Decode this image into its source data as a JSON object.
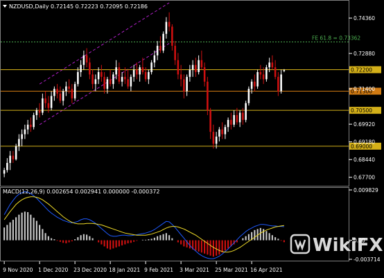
{
  "chart_data": [
    {
      "type": "candlestick",
      "title": "NZDUSD,Daily",
      "header_values": "0.72145 0.72223 0.72095 0.72186",
      "ylim": [
        0.674,
        0.75
      ],
      "y_ticks": [
        "0.74360",
        "0.72880",
        "0.71400",
        "0.69920",
        "0.69180",
        "0.68440",
        "0.67700"
      ],
      "x_ticks": [
        "9 Nov 2020",
        "1 Dec 2020",
        "23 Dec 2020",
        "18 Jan 2021",
        "9 Feb 2021",
        "3 Mar 2021",
        "25 Mar 2021",
        "16 Apr 2021"
      ],
      "levels": [
        {
          "label": "0.72200",
          "value": 0.722,
          "color": "#d4b019"
        },
        {
          "label": "0.71300",
          "value": 0.713,
          "color": "#d07a12"
        },
        {
          "label": "0.70500",
          "value": 0.705,
          "color": "#d4b019"
        },
        {
          "label": "0.69000",
          "value": 0.69,
          "color": "#d4b019"
        }
      ],
      "fibo": {
        "label": "FE 61.8 = 0.73362",
        "value": 0.73362,
        "color": "#4caf50"
      },
      "up_color": "#ffffff",
      "down_color": "#d01010",
      "channel_color": "#b020c8",
      "channel": [
        {
          "from": {
            "i": 12,
            "v": 0.716
          },
          "to": {
            "i": 56,
            "v": 0.75
          }
        },
        {
          "from": {
            "i": 12,
            "v": 0.699
          },
          "to": {
            "i": 56,
            "v": 0.733
          }
        }
      ],
      "candles": [
        [
          0.6785,
          0.681,
          0.677,
          0.68
        ],
        [
          0.68,
          0.685,
          0.679,
          0.683
        ],
        [
          0.683,
          0.688,
          0.68,
          0.686
        ],
        [
          0.686,
          0.688,
          0.683,
          0.6845
        ],
        [
          0.6845,
          0.691,
          0.684,
          0.69
        ],
        [
          0.69,
          0.695,
          0.688,
          0.693
        ],
        [
          0.693,
          0.697,
          0.69,
          0.695
        ],
        [
          0.695,
          0.699,
          0.693,
          0.697
        ],
        [
          0.697,
          0.701,
          0.695,
          0.699
        ],
        [
          0.699,
          0.702,
          0.696,
          0.698
        ],
        [
          0.698,
          0.704,
          0.697,
          0.703
        ],
        [
          0.703,
          0.706,
          0.701,
          0.705
        ],
        [
          0.705,
          0.708,
          0.702,
          0.704
        ],
        [
          0.704,
          0.712,
          0.703,
          0.71
        ],
        [
          0.71,
          0.713,
          0.706,
          0.708
        ],
        [
          0.708,
          0.711,
          0.704,
          0.706
        ],
        [
          0.706,
          0.713,
          0.705,
          0.711
        ],
        [
          0.711,
          0.715,
          0.709,
          0.714
        ],
        [
          0.714,
          0.716,
          0.71,
          0.712
        ],
        [
          0.712,
          0.715,
          0.708,
          0.709
        ],
        [
          0.709,
          0.714,
          0.707,
          0.713
        ],
        [
          0.713,
          0.717,
          0.711,
          0.715
        ],
        [
          0.715,
          0.718,
          0.712,
          0.714
        ],
        [
          0.714,
          0.716,
          0.708,
          0.71
        ],
        [
          0.71,
          0.717,
          0.709,
          0.716
        ],
        [
          0.716,
          0.723,
          0.715,
          0.721
        ],
        [
          0.721,
          0.726,
          0.719,
          0.724
        ],
        [
          0.724,
          0.73,
          0.722,
          0.728
        ],
        [
          0.728,
          0.731,
          0.723,
          0.725
        ],
        [
          0.725,
          0.727,
          0.718,
          0.72
        ],
        [
          0.72,
          0.722,
          0.714,
          0.716
        ],
        [
          0.716,
          0.72,
          0.713,
          0.718
        ],
        [
          0.718,
          0.723,
          0.716,
          0.721
        ],
        [
          0.721,
          0.724,
          0.717,
          0.719
        ],
        [
          0.719,
          0.721,
          0.712,
          0.714
        ],
        [
          0.714,
          0.719,
          0.712,
          0.718
        ],
        [
          0.718,
          0.722,
          0.715,
          0.716
        ],
        [
          0.716,
          0.721,
          0.714,
          0.72
        ],
        [
          0.72,
          0.726,
          0.718,
          0.723
        ],
        [
          0.723,
          0.725,
          0.716,
          0.717
        ],
        [
          0.717,
          0.721,
          0.715,
          0.719
        ],
        [
          0.719,
          0.723,
          0.716,
          0.718
        ],
        [
          0.718,
          0.722,
          0.714,
          0.715
        ],
        [
          0.715,
          0.72,
          0.713,
          0.719
        ],
        [
          0.719,
          0.724,
          0.717,
          0.722
        ],
        [
          0.722,
          0.725,
          0.718,
          0.72
        ],
        [
          0.72,
          0.724,
          0.717,
          0.723
        ],
        [
          0.723,
          0.727,
          0.72,
          0.721
        ],
        [
          0.721,
          0.723,
          0.717,
          0.718
        ],
        [
          0.718,
          0.722,
          0.716,
          0.721
        ],
        [
          0.721,
          0.726,
          0.72,
          0.725
        ],
        [
          0.725,
          0.73,
          0.723,
          0.728
        ],
        [
          0.728,
          0.734,
          0.726,
          0.732
        ],
        [
          0.732,
          0.736,
          0.729,
          0.73
        ],
        [
          0.73,
          0.738,
          0.729,
          0.737
        ],
        [
          0.737,
          0.744,
          0.735,
          0.742
        ],
        [
          0.742,
          0.746,
          0.738,
          0.74
        ],
        [
          0.74,
          0.741,
          0.73,
          0.732
        ],
        [
          0.732,
          0.734,
          0.724,
          0.726
        ],
        [
          0.726,
          0.729,
          0.718,
          0.72
        ],
        [
          0.72,
          0.724,
          0.715,
          0.718
        ],
        [
          0.718,
          0.72,
          0.71,
          0.713
        ],
        [
          0.713,
          0.72,
          0.711,
          0.719
        ],
        [
          0.719,
          0.724,
          0.717,
          0.722
        ],
        [
          0.722,
          0.726,
          0.719,
          0.724
        ],
        [
          0.724,
          0.727,
          0.719,
          0.721
        ],
        [
          0.721,
          0.728,
          0.72,
          0.726
        ],
        [
          0.726,
          0.73,
          0.722,
          0.723
        ],
        [
          0.723,
          0.725,
          0.715,
          0.717
        ],
        [
          0.717,
          0.719,
          0.703,
          0.705
        ],
        [
          0.705,
          0.706,
          0.693,
          0.696
        ],
        [
          0.696,
          0.699,
          0.689,
          0.691
        ],
        [
          0.691,
          0.696,
          0.689,
          0.694
        ],
        [
          0.694,
          0.698,
          0.692,
          0.697
        ],
        [
          0.697,
          0.7,
          0.693,
          0.695
        ],
        [
          0.695,
          0.699,
          0.693,
          0.698
        ],
        [
          0.698,
          0.702,
          0.696,
          0.701
        ],
        [
          0.701,
          0.704,
          0.697,
          0.699
        ],
        [
          0.699,
          0.705,
          0.698,
          0.703
        ],
        [
          0.703,
          0.706,
          0.699,
          0.7
        ],
        [
          0.7,
          0.705,
          0.698,
          0.704
        ],
        [
          0.704,
          0.706,
          0.699,
          0.701
        ],
        [
          0.701,
          0.709,
          0.7,
          0.708
        ],
        [
          0.708,
          0.715,
          0.707,
          0.714
        ],
        [
          0.714,
          0.718,
          0.712,
          0.717
        ],
        [
          0.717,
          0.72,
          0.713,
          0.715
        ],
        [
          0.715,
          0.722,
          0.714,
          0.721
        ],
        [
          0.721,
          0.724,
          0.718,
          0.72
        ],
        [
          0.72,
          0.723,
          0.716,
          0.718
        ],
        [
          0.718,
          0.724,
          0.717,
          0.723
        ],
        [
          0.723,
          0.727,
          0.721,
          0.725
        ],
        [
          0.725,
          0.728,
          0.722,
          0.723
        ],
        [
          0.723,
          0.726,
          0.718,
          0.719
        ],
        [
          0.719,
          0.721,
          0.711,
          0.713
        ],
        [
          0.713,
          0.722,
          0.712,
          0.72
        ],
        [
          0.72145,
          0.72223,
          0.72095,
          0.72186
        ]
      ]
    },
    {
      "type": "macd",
      "title": "MACD(12,26,9) 0.002654 0.002941 0.000000 -0.000372",
      "ylim": [
        -0.003714,
        0.009829
      ],
      "y_ticks": [
        "0.009829",
        "0.00",
        "-0.003714"
      ],
      "zero": 0,
      "histogram_color": "#c8c8c8",
      "negative_color": "#d01010",
      "signal_color": "#f0dc28",
      "macd_color": "#1e5aff",
      "histogram": [
        0.0025,
        0.003,
        0.0035,
        0.004,
        0.0045,
        0.005,
        0.0054,
        0.0056,
        0.0055,
        0.005,
        0.0044,
        0.0038,
        0.003,
        0.0022,
        0.0014,
        0.0008,
        0.0004,
        0.0002,
        -0.0001,
        -0.0003,
        -0.0005,
        -0.0006,
        -0.0004,
        -0.0002,
        0.0002,
        0.0006,
        0.001,
        0.0012,
        0.0011,
        0.0008,
        0.0004,
        0.0,
        -0.0004,
        -0.0008,
        -0.0012,
        -0.0016,
        -0.0018,
        -0.0016,
        -0.0014,
        -0.0012,
        -0.001,
        -0.0008,
        -0.0006,
        -0.0005,
        -0.0003,
        -0.0001,
        0.0,
        0.0001,
        0.0001,
        0.0002,
        0.0003,
        0.0005,
        0.0008,
        0.001,
        0.0012,
        0.0014,
        0.001,
        0.0004,
        0.0,
        -0.0004,
        -0.0008,
        -0.0012,
        -0.0014,
        -0.0016,
        -0.0018,
        -0.002,
        -0.0022,
        -0.0024,
        -0.0026,
        -0.0028,
        -0.003,
        -0.0032,
        -0.003,
        -0.0028,
        -0.0024,
        -0.002,
        -0.0016,
        -0.0012,
        -0.0008,
        -0.0004,
        0.0,
        0.0004,
        0.0008,
        0.0012,
        0.0016,
        0.002,
        0.0022,
        0.0024,
        0.0022,
        0.0018,
        0.0014,
        0.001,
        0.0006,
        0.0003,
        -0.0001,
        -0.00037
      ],
      "signal": [
        0.004,
        0.0048,
        0.0056,
        0.0063,
        0.007,
        0.0075,
        0.0079,
        0.0082,
        0.0084,
        0.0085,
        0.0085,
        0.0084,
        0.0082,
        0.0079,
        0.0075,
        0.0071,
        0.0066,
        0.0061,
        0.0056,
        0.0051,
        0.0046,
        0.0042,
        0.0038,
        0.0035,
        0.0033,
        0.0032,
        0.0032,
        0.0032,
        0.0033,
        0.0033,
        0.0033,
        0.0032,
        0.0031,
        0.003,
        0.0028,
        0.0026,
        0.0024,
        0.0022,
        0.002,
        0.0018,
        0.0016,
        0.0014,
        0.0013,
        0.0012,
        0.0011,
        0.001,
        0.001,
        0.001,
        0.001,
        0.0011,
        0.0012,
        0.0014,
        0.0016,
        0.0018,
        0.0021,
        0.0024,
        0.0026,
        0.0027,
        0.0027,
        0.0026,
        0.0024,
        0.0022,
        0.0019,
        0.0016,
        0.0013,
        0.001,
        0.0006,
        0.0002,
        -0.0002,
        -0.0006,
        -0.001,
        -0.0014,
        -0.0017,
        -0.002,
        -0.0022,
        -0.0023,
        -0.0023,
        -0.0022,
        -0.002,
        -0.0017,
        -0.0014,
        -0.001,
        -0.0006,
        -0.0002,
        0.0002,
        0.0006,
        0.001,
        0.0014,
        0.0017,
        0.002,
        0.0022,
        0.0024,
        0.0026,
        0.0027,
        0.0028,
        0.0029
      ],
      "macd": [
        0.005,
        0.006,
        0.007,
        0.0078,
        0.0085,
        0.009,
        0.0093,
        0.0095,
        0.0094,
        0.0091,
        0.0087,
        0.0082,
        0.0076,
        0.007,
        0.0064,
        0.0058,
        0.0053,
        0.0049,
        0.0045,
        0.0042,
        0.0039,
        0.0037,
        0.0035,
        0.0034,
        0.0035,
        0.0037,
        0.004,
        0.0042,
        0.0042,
        0.004,
        0.0037,
        0.0033,
        0.0028,
        0.0023,
        0.0018,
        0.0013,
        0.0009,
        0.0008,
        0.0008,
        0.0009,
        0.001,
        0.001,
        0.0009,
        0.0009,
        0.001,
        0.0011,
        0.0012,
        0.0013,
        0.0014,
        0.0016,
        0.0018,
        0.0021,
        0.0025,
        0.0029,
        0.0033,
        0.0037,
        0.0036,
        0.0031,
        0.0025,
        0.0018,
        0.0011,
        0.0004,
        -0.0003,
        -0.001,
        -0.0016,
        -0.0021,
        -0.0026,
        -0.003,
        -0.0033,
        -0.0035,
        -0.0036,
        -0.0036,
        -0.0034,
        -0.0031,
        -0.0027,
        -0.0022,
        -0.0017,
        -0.0011,
        -0.0005,
        0.0001,
        0.0007,
        0.0012,
        0.0017,
        0.0021,
        0.0024,
        0.0027,
        0.0029,
        0.0031,
        0.0031,
        0.003,
        0.0029,
        0.0028,
        0.0028,
        0.0027,
        0.0027,
        0.002654
      ]
    }
  ],
  "watermark": {
    "text": "WikiFX"
  }
}
